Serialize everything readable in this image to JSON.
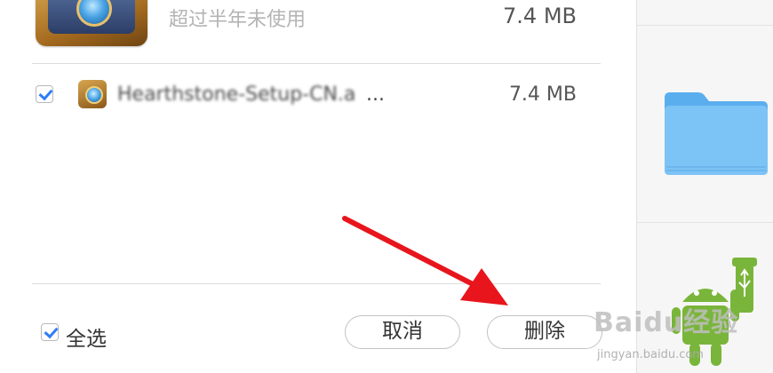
{
  "app": {
    "subtitle": "超过半年未使用",
    "size": "7.4 MB",
    "icon": "hearthstone-app-icon"
  },
  "files": [
    {
      "checked": true,
      "icon": "hearthstone-file-icon",
      "name": "Hearthstone-Setup-CN.a",
      "ellipsis": "...",
      "size": "7.4 MB"
    }
  ],
  "footer": {
    "select_all_label": "全选",
    "select_all_checked": true,
    "cancel_label": "取消",
    "delete_label": "删除"
  },
  "sidebar": {
    "icon": "folder-icon"
  },
  "watermark": {
    "brand": "Baidu经验",
    "url": "jingyan.baidu.com"
  },
  "colors": {
    "accent": "#2f7df6",
    "annotation_arrow": "#e8151c",
    "folder": "#6cb8f2"
  }
}
